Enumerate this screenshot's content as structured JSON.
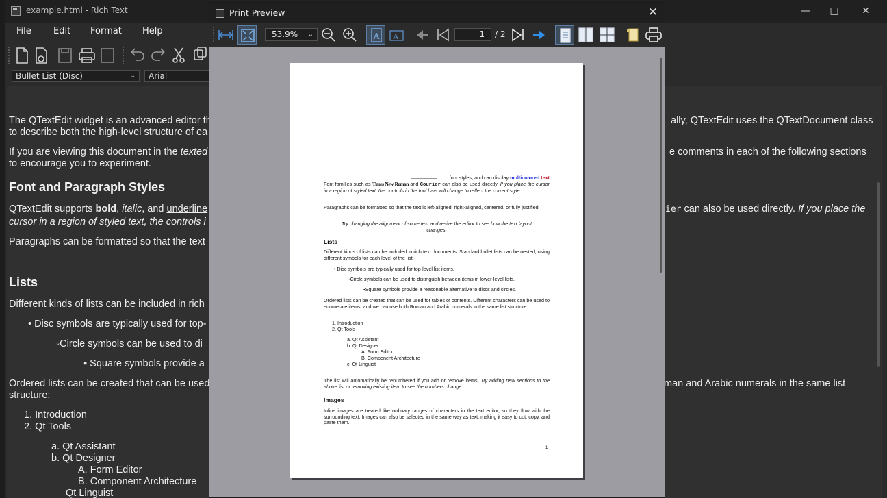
{
  "main": {
    "title": "example.html - Rich Text",
    "menu": [
      "File",
      "Edit",
      "Format",
      "Help"
    ],
    "style_combo": "Bullet List (Disc)",
    "font_combo": "Arial",
    "doc": {
      "p1_a": "The QTextEdit widget is an advanced editor th",
      "p1_b": "to describe both the high-level structure of ea",
      "p1_right": "ally, QTextEdit uses the QTextDocument class",
      "p2_a_pre": "If you are viewing this document in the ",
      "p2_a_em": "texted",
      "p2_b": "to encourage you to experiment.",
      "p2_right": "e comments in each of the following sections",
      "h_font": "Font and Paragraph Styles",
      "p3_pre": "QTextEdit supports ",
      "p3_bold": "bold",
      "p3_comma": ", ",
      "p3_italic": "italic",
      "p3_and": ", and ",
      "p3_underline": "underline",
      "p3_b": "cursor in a region of styled text, the controls i",
      "p3_right_mono": "ier",
      "p3_right_text": " can also be used directly. ",
      "p3_right_em": "If you place the",
      "p4": "Paragraphs can be formatted so that the text",
      "h_lists": "Lists",
      "p5": "Different kinds of lists can be included in rich",
      "li_disc": "Disc symbols are typically used for top-",
      "li_circle": "Circle symbols can be used to di",
      "li_square": "Square symbols provide a",
      "p6_a": "Ordered lists can be created that can be used",
      "p6_b": "structure:",
      "p6_right": "man and Arabic numerals in the same list",
      "ol": [
        "Introduction",
        "Qt Tools"
      ],
      "ol_sub": [
        "Qt Assistant",
        "Qt Designer"
      ],
      "ol_subsub": [
        "Form Editor",
        "Component Architecture"
      ],
      "ol_sub_c": "Qt Linguist",
      "marker_1": "1.",
      "marker_2": "2.",
      "marker_a": "a.",
      "marker_b": "b.",
      "marker_A": "A.",
      "marker_B": "B.",
      "bullet_disc": "•",
      "bullet_circle": "◦",
      "bullet_square": "▪"
    }
  },
  "preview": {
    "title": "Print Preview",
    "zoom": "53.9%",
    "page_current": "1",
    "page_total": "/ 2",
    "close": "✕",
    "page": {
      "frag_top": "font styles, and can display ",
      "frag_multi": "multicolored",
      "frag_text": " text",
      "ff_pre": "Font families such as ",
      "ff_times": "Times New Roman",
      "ff_and": " and ",
      "ff_courier": "Courier",
      "ff_post": " can also be used directly. ",
      "ff_em": "If you place the cursor in a region of styled text, the controls in the tool bars will change to reflect the current style.",
      "para_align": "Paragraphs can be formatted so that the text is left-aligned, right-aligned, centered, or fully justified.",
      "try_align": "Try changing the alignment of some text and resize the editor to see how the text layout changes.",
      "h_lists": "Lists",
      "lists_intro": "Different kinds of lists can be included in rich text documents. Standard bullet lists can be nested, using different symbols for each level of the list:",
      "li_disc": "Disc symbols are typically used for top-level list items.",
      "li_circle": "Circle symbols can be used to distinguish between items in lower-level lists.",
      "li_square": "Square symbols provide a reasonable alternative to discs and circles.",
      "ordered_intro": "Ordered lists can be created that can be used for tables of contents. Different characters can be used to enumerate items, and we can use both Roman and Arabic numerals in the same list structure:",
      "ol1": "1. Introduction",
      "ol2": "2. Qt Tools",
      "ola": "a. Qt Assistant",
      "olb": "b. Qt Designer",
      "olA": "A. Form Editor",
      "olB": "B. Component Architecture",
      "olc": "c. Qt Linguist",
      "renumber": "The list will automatically be renumbered if you add or remove items. ",
      "renumber_em": "Try adding new sections to the above list or removing existing item to see the numbers change.",
      "h_images": "Images",
      "images_text": "Inline images are treated like ordinary ranges of characters in the text editor, so they flow with the surrounding text. Images can also be selected in the same way as text, making it easy to cut, copy, and paste them.",
      "page_number": "1"
    }
  },
  "colors": {
    "multicolor_blue": "#1c2bd8",
    "multicolor_red": "#c0102a",
    "active_button": "#3d4d5e"
  }
}
